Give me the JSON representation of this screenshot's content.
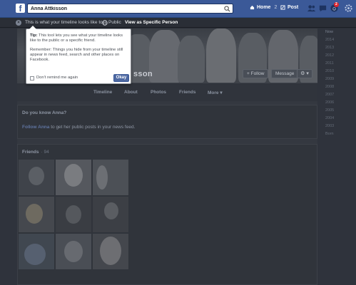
{
  "topbar": {
    "logo": "f",
    "search_value": "Anna Attkisson",
    "home_label": "Home",
    "home_count": "2",
    "post_label": "Post",
    "notifications_badge": "2"
  },
  "viewbar": {
    "text": "This is what your timeline looks like to:",
    "audience": "Public",
    "view_specific": "View as Specific Person"
  },
  "tooltip": {
    "tip_label": "Tip:",
    "tip_text": "This tool lets you see what your timeline looks like to the public or a specific friend.",
    "remember_text": "Remember: Things you hide from your timeline still appear in news feed, search and other places on Facebook.",
    "dont_remind": "Don't remind me again",
    "okay": "Okay"
  },
  "profile": {
    "name_partial": "sson",
    "follow": "+ Follow",
    "message": "Message",
    "gear": "⚙ ▾",
    "nav": [
      "Timeline",
      "About",
      "Photos",
      "Friends",
      "More ▾"
    ]
  },
  "know_card": {
    "title": "Do you know Anna?",
    "link": "Follow Anna",
    "text": " to get her public posts in your news feed."
  },
  "friends": {
    "title": "Friends",
    "count": "· 94"
  },
  "scrubber": {
    "years": [
      "Now",
      "2014",
      "2013",
      "2012",
      "2011",
      "2010",
      "2009",
      "2008",
      "2007",
      "2006",
      "2005",
      "2004",
      "2003",
      "Born"
    ]
  },
  "colors": {
    "topbar": "#3b5998",
    "badge": "#e0242c",
    "okay_button": "#4e69a2"
  }
}
